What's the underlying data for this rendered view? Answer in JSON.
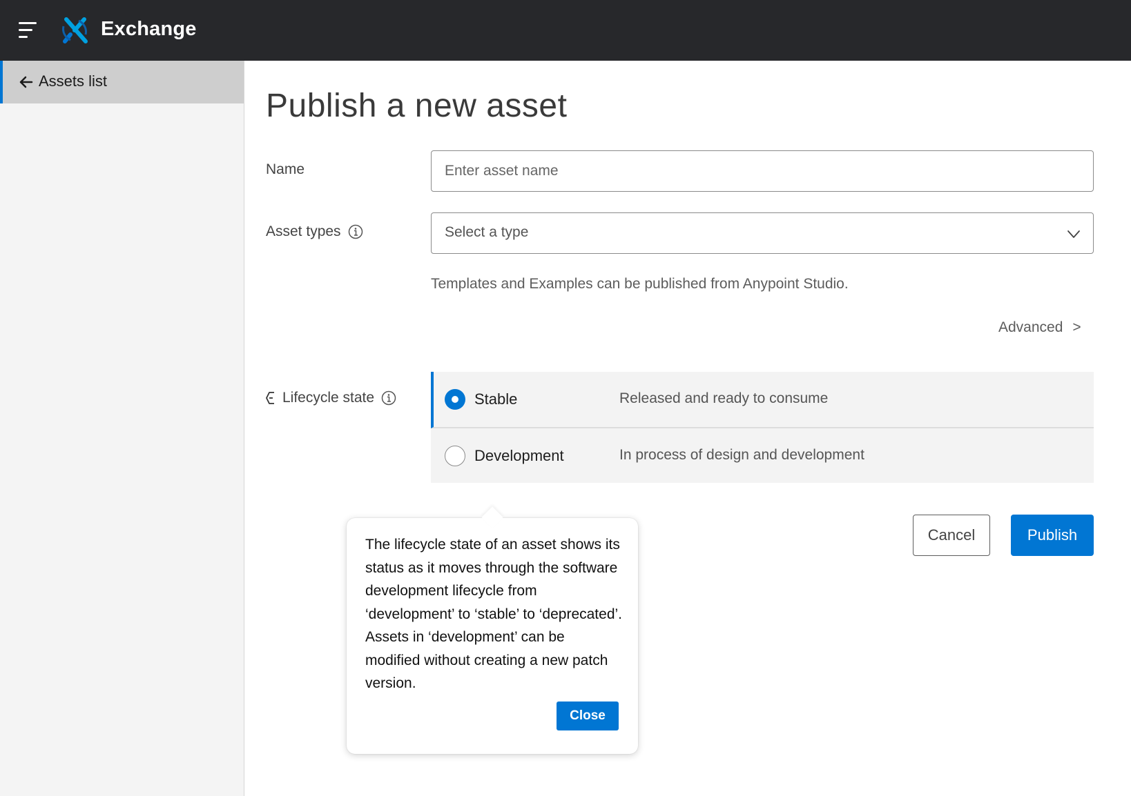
{
  "header": {
    "app_title": "Exchange",
    "menu_icon": "hamburger-menu-icon",
    "logo_icon": "exchange-logo-icon"
  },
  "sidebar": {
    "back_label": "Assets list",
    "back_icon": "arrow-left-icon"
  },
  "main": {
    "page_title": "Publish a new asset",
    "name": {
      "label": "Name",
      "value": "",
      "placeholder": "Enter asset name"
    },
    "asset_types": {
      "label": "Asset types",
      "selected": "Select a type",
      "info_icon": "info-icon",
      "dropdown_icon": "chevron-down-icon"
    },
    "helper_text": "Templates and Examples can be published from Anypoint Studio.",
    "advanced": {
      "label": "Advanced",
      "chevron": ">"
    },
    "lifecycle": {
      "label": "Lifecycle state",
      "icon": "lifecycle-icon",
      "info_icon": "info-icon",
      "options": [
        {
          "label": "Stable",
          "description": "Released and ready to consume",
          "selected": true
        },
        {
          "label": "Development",
          "description": "In process of design and development",
          "selected": false
        }
      ]
    },
    "buttons": {
      "cancel": "Cancel",
      "publish": "Publish"
    }
  },
  "popover": {
    "text": "The lifecycle state of an asset shows its status as it moves through the software development lifecycle from ‘development’ to ‘stable’ to ‘deprecated’. Assets in ‘development’ can be modified without creating a new patch version.",
    "close_label": "Close"
  },
  "colors": {
    "topbar_bg": "#27282b",
    "accent": "#0176d3",
    "logo_accent": "#00a1e0",
    "sidebar_bg": "#f4f4f4",
    "sidebar_active_bg": "#cecece",
    "radio_row_bg": "#f3f3f3"
  }
}
